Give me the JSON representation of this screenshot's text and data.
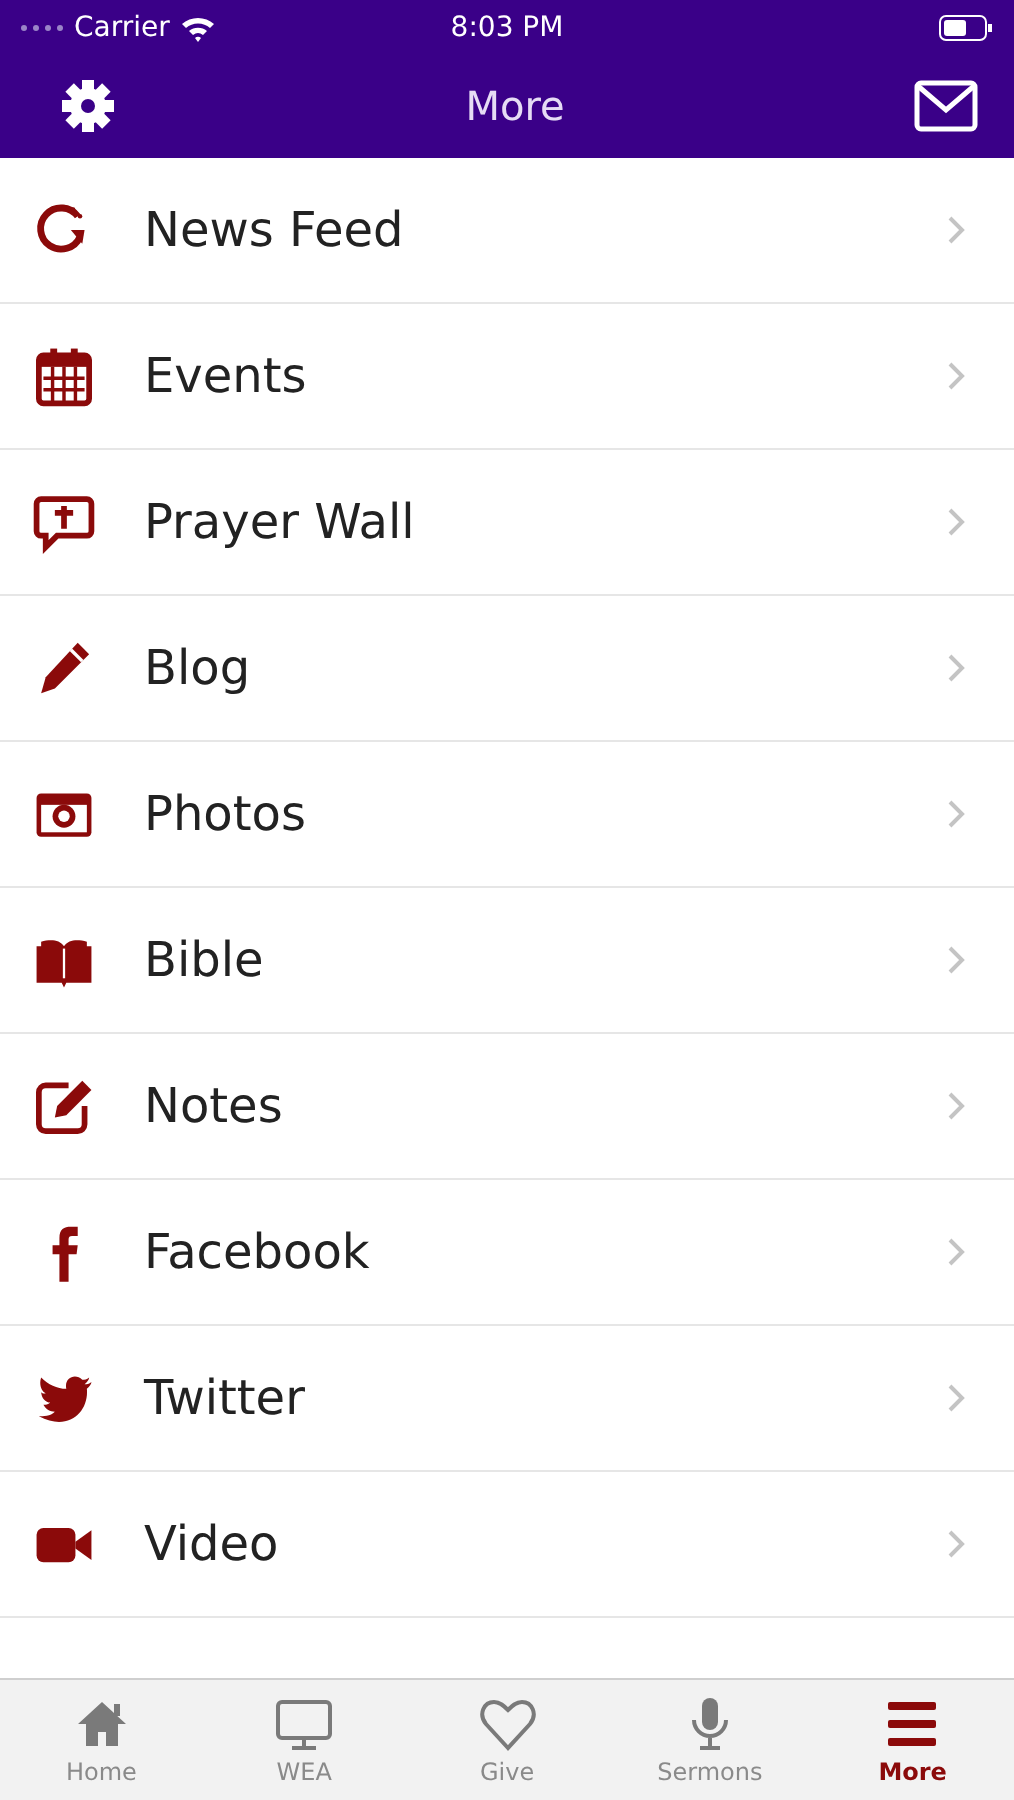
{
  "status_bar": {
    "carrier": "Carrier",
    "time": "8:03 PM"
  },
  "nav_bar": {
    "title": "More"
  },
  "menu": [
    {
      "label": "News Feed"
    },
    {
      "label": "Events"
    },
    {
      "label": "Prayer Wall"
    },
    {
      "label": "Blog"
    },
    {
      "label": "Photos"
    },
    {
      "label": "Bible"
    },
    {
      "label": "Notes"
    },
    {
      "label": "Facebook"
    },
    {
      "label": "Twitter"
    },
    {
      "label": "Video"
    }
  ],
  "tab_bar": [
    {
      "label": "Home",
      "selected": false
    },
    {
      "label": "WEA",
      "selected": false
    },
    {
      "label": "Give",
      "selected": false
    },
    {
      "label": "Sermons",
      "selected": false
    },
    {
      "label": "More",
      "selected": true
    }
  ]
}
